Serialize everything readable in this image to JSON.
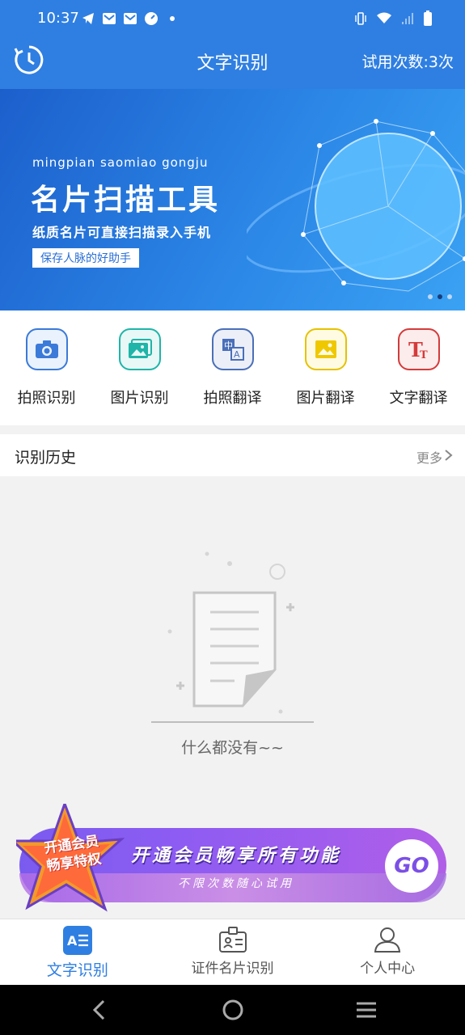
{
  "status": {
    "time": "10:37"
  },
  "header": {
    "title": "文字识别",
    "trial": "试用次数:3次"
  },
  "banner": {
    "pinyin": "mingpian saomiao gongju",
    "title": "名片扫描工具",
    "subtitle": "纸质名片可直接扫描录入手机",
    "tag": "保存人脉的好助手"
  },
  "functions": [
    {
      "label": "拍照识别",
      "icon": "camera-icon",
      "color": "#3b7ad8"
    },
    {
      "label": "图片识别",
      "icon": "image-icon",
      "color": "#1fb5a8"
    },
    {
      "label": "拍照翻译",
      "icon": "translate-icon",
      "color": "#4a6fb8"
    },
    {
      "label": "图片翻译",
      "icon": "picture-translate-icon",
      "color": "#e6c200"
    },
    {
      "label": "文字翻译",
      "icon": "text-translate-icon",
      "color": "#d43b3b"
    }
  ],
  "history": {
    "title": "识别历史",
    "more": "更多"
  },
  "empty": {
    "text": "什么都没有~~"
  },
  "promo": {
    "badge_line1": "开通会员",
    "badge_line2": "畅享特权",
    "title": "开通会员畅享所有功能",
    "subtitle": "不限次数随心试用",
    "button": "GO"
  },
  "nav": [
    {
      "label": "文字识别",
      "icon": "text-recognition-icon",
      "active": true
    },
    {
      "label": "证件名片识别",
      "icon": "id-card-icon",
      "active": false
    },
    {
      "label": "个人中心",
      "icon": "user-icon",
      "active": false
    }
  ],
  "colors": {
    "primary": "#2f7fe2"
  }
}
